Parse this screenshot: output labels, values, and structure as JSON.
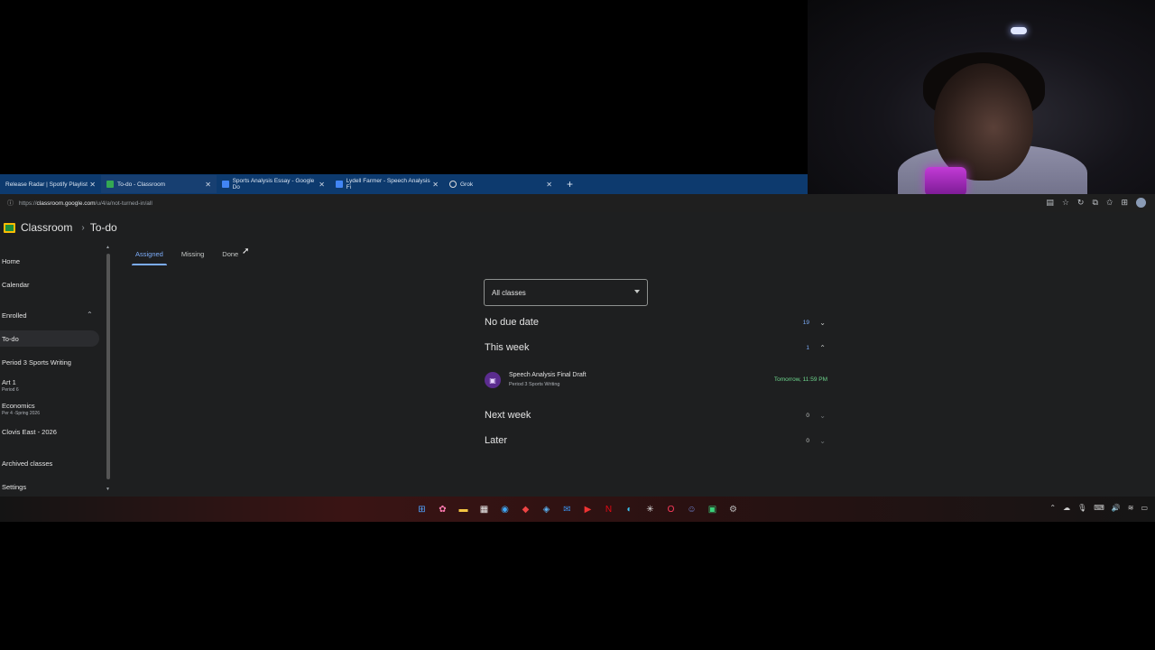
{
  "browser": {
    "tabs": [
      {
        "label": "Release Radar | Spotify Playlist",
        "fav_color": "#1db954",
        "active": false
      },
      {
        "label": "To-do - Classroom",
        "fav_color": "#34a853",
        "active": true
      },
      {
        "label": "Sports Analysis Essay - Google Do",
        "fav_color": "#4285f4",
        "active": false
      },
      {
        "label": "Lydell Farmer - Speech Analysis Fi",
        "fav_color": "#4285f4",
        "active": false
      },
      {
        "label": "Grok",
        "fav_color": "#ffffff",
        "active": false
      }
    ],
    "url_prefix": "https://",
    "url_host": "classroom.google.com",
    "url_path": "/u/4/a/not-turned-in/all"
  },
  "header": {
    "brand": "Classroom",
    "crumb": "To-do"
  },
  "sidebar": {
    "home": "Home",
    "calendar": "Calendar",
    "enrolled": "Enrolled",
    "todo": "To-do",
    "classes": [
      {
        "name": "Period 3 Sports Writing",
        "sub": ""
      },
      {
        "name": "Art 1",
        "sub": "Period 6"
      },
      {
        "name": "Economics",
        "sub": "Per 4 -Spring 2026"
      },
      {
        "name": "Clovis East - 2026",
        "sub": ""
      }
    ],
    "archived": "Archived classes",
    "settings": "Settings"
  },
  "page_tabs": {
    "assigned": "Assigned",
    "missing": "Missing",
    "done": "Done"
  },
  "filter": {
    "selected": "All classes"
  },
  "groups": {
    "no_due": {
      "title": "No due date",
      "count": "19"
    },
    "this_week": {
      "title": "This week",
      "count": "1"
    },
    "next_week": {
      "title": "Next week",
      "count": "0"
    },
    "later": {
      "title": "Later",
      "count": "0"
    }
  },
  "assignment": {
    "title": "Speech Analysis Final Draft",
    "class": "Period 3 Sports Writing",
    "due": "Tomorrow, 11:59 PM"
  },
  "colors": {
    "accent": "#7cacf8",
    "due_green": "#6dd58c",
    "tabbar": "#0d3a6e"
  },
  "icons": {
    "expand": "chevron-down-icon",
    "collapse": "chevron-up-icon",
    "assignment": "assignment-icon"
  }
}
